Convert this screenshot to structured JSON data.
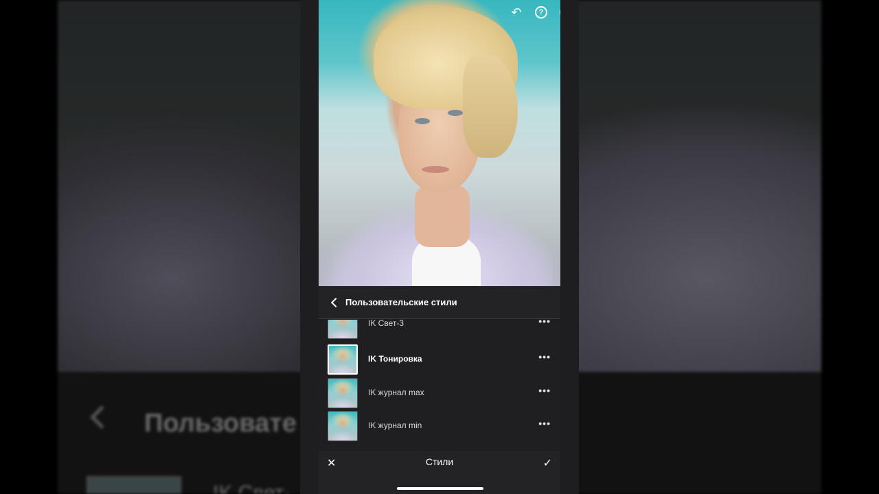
{
  "background": {
    "title": "Пользовате",
    "item": "IK Свет-"
  },
  "toolbar": {
    "undo_icon": "↶",
    "help_icon": "?",
    "more_icon": "•••"
  },
  "panel": {
    "title": "Пользовательские стили",
    "items": [
      {
        "label": "IK Свет-3",
        "more": "•••",
        "selected": false
      },
      {
        "label": "IK Тонировка",
        "more": "•••",
        "selected": true
      },
      {
        "label": "IK журнал max",
        "more": "•••",
        "selected": false
      },
      {
        "label": "IK журнал min",
        "more": "•••",
        "selected": false
      }
    ]
  },
  "bottom_bar": {
    "title": "Стили",
    "cancel": "✕",
    "confirm": "✓"
  },
  "colors": {
    "panel_bg": "#232224",
    "list_bg": "#1f1e20",
    "text": "#ffffff"
  }
}
